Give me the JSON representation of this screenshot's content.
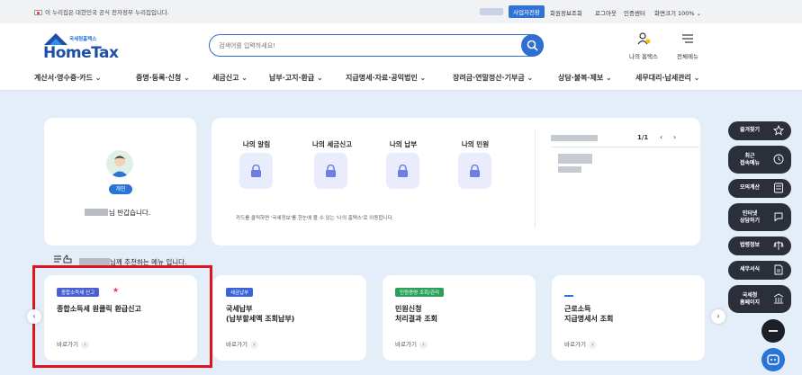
{
  "topbar": {
    "gov_notice": "이 누리집은 대한민국 공식 전자정부 누리집입니다.",
    "biz_button": "사업자전환",
    "links": [
      "회원정보조회",
      "로그아웃",
      "인증센터",
      "화면크기 100% ⌄"
    ]
  },
  "header": {
    "logo_sub": "국세청홈택스",
    "logo_text": "HomeTax",
    "search_placeholder": "검색어를 입력하세요!",
    "my_hometax": "나의 홈택스",
    "all_menu": "전체메뉴"
  },
  "nav": {
    "items": [
      "계산서·영수증·카드 ⌄",
      "증명·등록·신청 ⌄",
      "세금신고 ⌄",
      "납부·고지·환급 ⌄",
      "지급명세·자료·공익법인 ⌄",
      "장려금·연말정산·기부금 ⌄",
      "상담·불복·제보 ⌄",
      "세무대리·납세관리 ⌄"
    ]
  },
  "profile": {
    "role_badge": "개인",
    "greeting_suffix": "님 반갑습니다."
  },
  "quick_menus": {
    "items": [
      "나의 알림",
      "나의 세금신고",
      "나의 납부",
      "나의 민원"
    ],
    "hint": "카드를 클릭하면 '국세정보'를 한눈에 볼 수 있는 '나의 홈택스'로 이동합니다."
  },
  "notice": {
    "pager": "1/1",
    "prev": "‹",
    "next": "›"
  },
  "recommend": {
    "title_suffix": "님께 추천하는 메뉴 입니다.",
    "go_label": "바로가기",
    "cards": [
      {
        "tag": "종합소득세 신고",
        "tag_color": "#4a5fd0",
        "name": "종합소득세 원클릭 환급신고"
      },
      {
        "tag": "세금납부",
        "tag_color": "#3a63d8",
        "name": "국세납부\n(납부할세액 조회납부)"
      },
      {
        "tag": "민원증명 조회/관리",
        "tag_color": "#2aa05a",
        "name": "민원신청\n처리결과 조회"
      },
      {
        "tag": "",
        "tag_color": "#2a74d6",
        "name": "근로소득\n지급명세서 조회"
      }
    ]
  },
  "side_menu": {
    "items": [
      "즐겨찾기",
      "최근\n접속메뉴",
      "모의계산",
      "인터넷\n상담하기",
      "법령정보",
      "세무서식",
      "국세청\n홈페이지"
    ]
  },
  "colors": {
    "primary": "#2f6fd1",
    "highlight": "#e0141c",
    "main_bg": "#e4eef9",
    "side_bg": "#2b2f3a"
  }
}
